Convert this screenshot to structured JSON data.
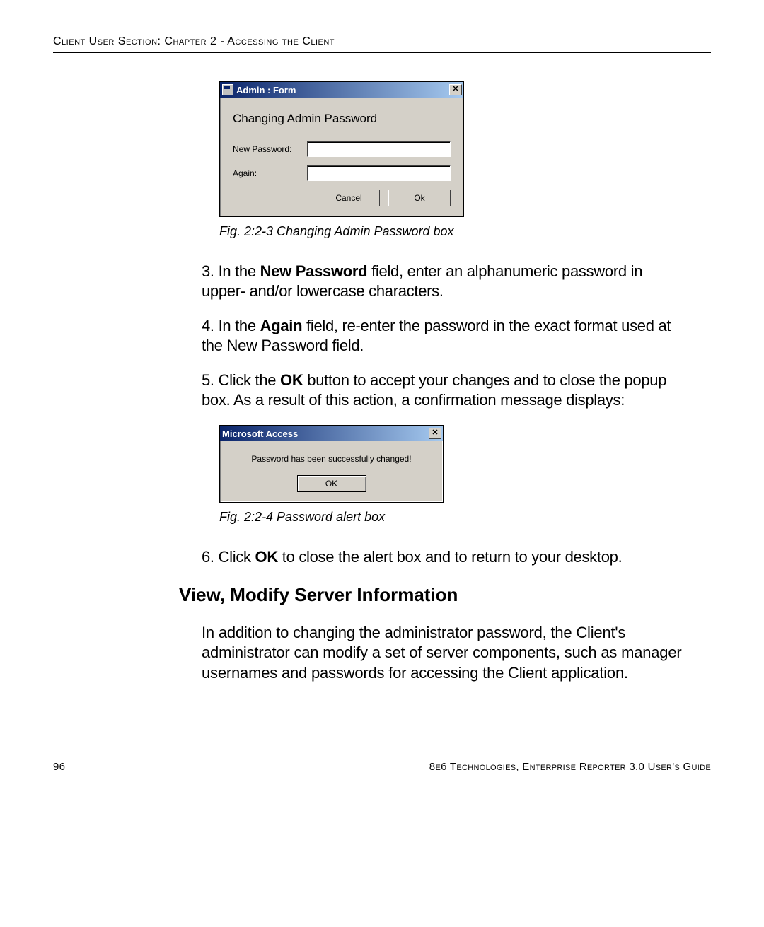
{
  "header": {
    "running_head": "Client User Section: Chapter 2 - Accessing the Client"
  },
  "dialog1": {
    "title": "Admin : Form",
    "close_label": "✕",
    "heading": "Changing Admin Password",
    "new_password_label": "New Password:",
    "again_label": "Again:",
    "new_password_value": "",
    "again_value": "",
    "cancel_label_pre": "",
    "cancel_underline": "C",
    "cancel_label_post": "ancel",
    "ok_label_pre": "",
    "ok_underline": "O",
    "ok_label_post": "k"
  },
  "caption1": "Fig. 2:2-3  Changing Admin Password box",
  "steps": {
    "s3_num": "3.",
    "s3_a": "In the ",
    "s3_b": "New Password",
    "s3_c": " field, enter an alphanumeric pass­word in upper- and/or lowercase characters.",
    "s4_num": "4.",
    "s4_a": "In the ",
    "s4_b": "Again",
    "s4_c": " field, re-enter the password in the exact format used at the New Password field.",
    "s5_num": "5.",
    "s5_a": "Click the ",
    "s5_b": "OK",
    "s5_c": " button to accept your changes and to close the popup box. As a result of this action, a confirmation message displays:",
    "s6_num": "6.",
    "s6_a": "Click ",
    "s6_b": "OK",
    "s6_c": " to close the alert box and to return to your desk­top."
  },
  "dialog2": {
    "title": "Microsoft Access",
    "close_label": "✕",
    "message": "Password has been successfully changed!",
    "ok_label": "OK"
  },
  "caption2": "Fig. 2:2-4  Password alert box",
  "section_heading": "View, Modify Server Information",
  "section_para": "In addition to changing the administrator password, the Client's administrator can modify a set of server components, such as manager usernames and passwords for accessing the Client application.",
  "footer": {
    "page_number": "96",
    "right": "8e6 Technologies, Enterprise Reporter 3.0 User's Guide"
  }
}
